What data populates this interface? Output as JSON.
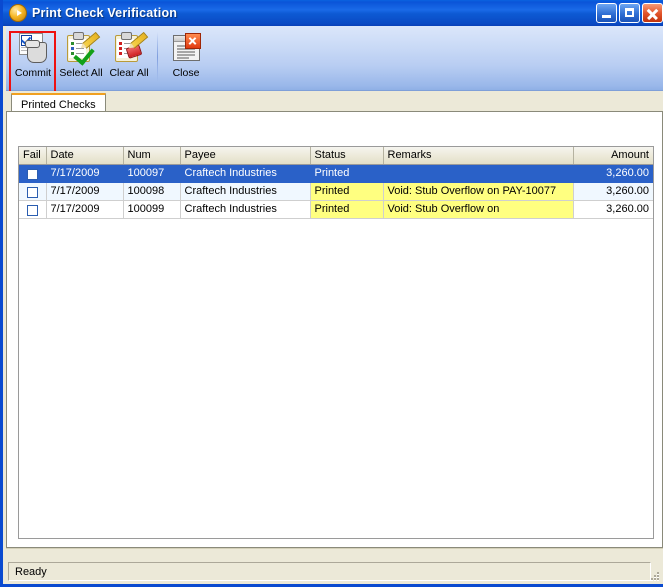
{
  "window": {
    "title": "Print Check Verification",
    "icon": "app-circle-arrow-icon",
    "controls": {
      "minimize": "Minimize",
      "maximize": "Maximize",
      "close": "Close"
    }
  },
  "toolbar": {
    "items": [
      {
        "label": "Commit",
        "icon": "commit-icon",
        "highlighted": true
      },
      {
        "label": "Select All",
        "icon": "select-all-icon",
        "highlighted": false
      },
      {
        "label": "Clear All",
        "icon": "clear-all-icon",
        "highlighted": false
      },
      {
        "label": "Close",
        "icon": "close-window-icon",
        "highlighted": false
      }
    ],
    "highlight_color": "#ee1111"
  },
  "tabs": [
    {
      "label": "Printed Checks",
      "active": true
    }
  ],
  "grid": {
    "columns": [
      "Fail",
      "Date",
      "Num",
      "Payee",
      "Status",
      "Remarks",
      "Amount"
    ],
    "rows": [
      {
        "fail": "",
        "date": "7/17/2009",
        "num": "100097",
        "payee": "Craftech Industries",
        "status": "Printed",
        "remarks": "",
        "amount": "3,260.00",
        "selected": true,
        "highlight": false
      },
      {
        "fail": "",
        "date": "7/17/2009",
        "num": "100098",
        "payee": "Craftech Industries",
        "status": "Printed",
        "remarks": "Void: Stub Overflow on PAY-10077",
        "amount": "3,260.00",
        "selected": false,
        "highlight": true
      },
      {
        "fail": "",
        "date": "7/17/2009",
        "num": "100099",
        "payee": "Craftech Industries",
        "status": "Printed",
        "remarks": "Void: Stub Overflow on",
        "amount": "3,260.00",
        "selected": false,
        "highlight": true
      }
    ],
    "selection_color": "#2a61c8",
    "highlight_color": "#ffff80"
  },
  "statusbar": {
    "text": "Ready"
  }
}
